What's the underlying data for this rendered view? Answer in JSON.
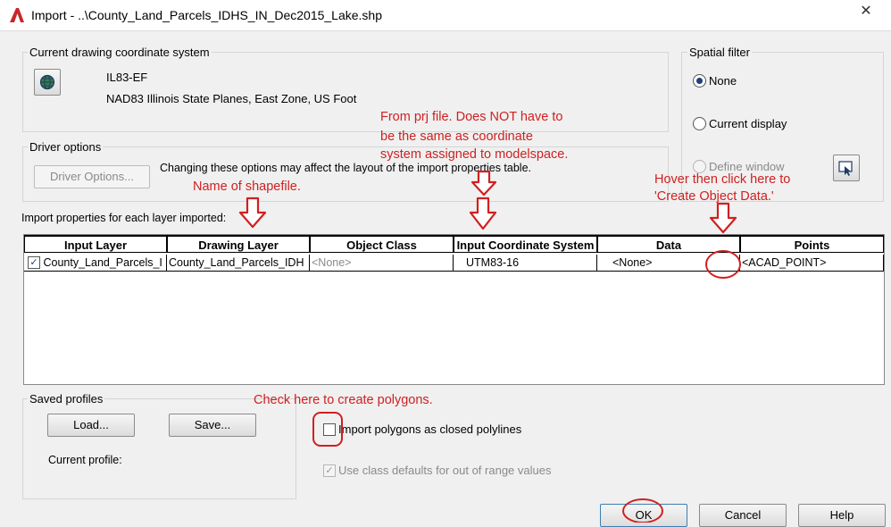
{
  "window": {
    "title": "Import - ..\\County_Land_Parcels_IDHS_IN_Dec2015_Lake.shp",
    "app_icon": "autocad-a-icon",
    "close_glyph": "✕"
  },
  "coord_system": {
    "group_label": "Current drawing coordinate system",
    "code": "IL83-EF",
    "description": "NAD83 Illinois State Planes, East Zone, US Foot",
    "icon": "globe-coordinate-icon"
  },
  "spatial_filter": {
    "group_label": "Spatial filter",
    "options": [
      {
        "label": "None",
        "selected": true,
        "enabled": true
      },
      {
        "label": "Current display",
        "selected": false,
        "enabled": true
      },
      {
        "label": "Define window",
        "selected": false,
        "enabled": false
      }
    ],
    "pick_icon": "define-window-pick-icon"
  },
  "driver_options": {
    "group_label": "Driver options",
    "button_label": "Driver Options...",
    "note": "Changing these options may affect the layout of the import properties table."
  },
  "import_props": {
    "label": "Import properties for each layer imported:",
    "columns": [
      "Input Layer",
      "Drawing Layer",
      "Object Class",
      "Input Coordinate System",
      "Data",
      "Points"
    ],
    "rows": [
      {
        "checked": true,
        "input_layer": "County_Land_Parcels_I",
        "drawing_layer": "County_Land_Parcels_IDH",
        "object_class": "<None>",
        "coord_system": "UTM83-16",
        "data": "<None>",
        "points": "<ACAD_POINT>"
      }
    ]
  },
  "saved_profiles": {
    "group_label": "Saved profiles",
    "load_label": "Load...",
    "save_label": "Save...",
    "current_profile_label": "Current profile:"
  },
  "options": {
    "polygons_label": "Import polygons as closed polylines",
    "polygons_checked": false,
    "class_defaults_label": "Use class defaults for out of range values",
    "class_defaults_checked": true
  },
  "footer": {
    "ok_label": "OK",
    "cancel_label": "Cancel",
    "help_label": "Help"
  },
  "annotations": {
    "prj_note": [
      "From prj file. Does NOT have to",
      "be the same as coordinate",
      "system assigned to modelspace."
    ],
    "shapefile_note": "Name of shapefile.",
    "hover_note": [
      "Hover then click here to",
      "'Create Object Data.'"
    ],
    "polygons_note": "Check here to create polygons.",
    "color": "#d02020"
  },
  "theme": {
    "accent": "#1e3f7a",
    "annotation": "#d02020"
  }
}
